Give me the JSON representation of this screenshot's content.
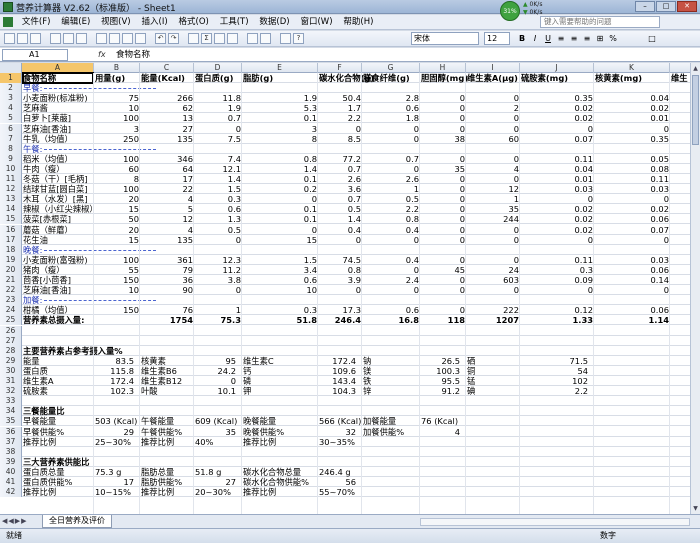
{
  "window": {
    "title": "营养计算器 V2.62（标准版） - Sheet1"
  },
  "system_monitor": {
    "cpu": "31%",
    "up": "0K/s",
    "down": "0K/s"
  },
  "menu": {
    "items": [
      "文件(F)",
      "编辑(E)",
      "视图(V)",
      "插入(I)",
      "格式(O)",
      "工具(T)",
      "数据(D)",
      "窗口(W)",
      "帮助(H)"
    ],
    "help_placeholder": "键入需要帮助的问题"
  },
  "toolbar": {
    "font": "宋体",
    "size": "12",
    "bold": "B",
    "italic": "I",
    "underline": "U"
  },
  "formula": {
    "cell": "A1",
    "fx": "fx",
    "value": "食物名称"
  },
  "columns": [
    "A",
    "B",
    "C",
    "D",
    "E",
    "F",
    "G",
    "H",
    "I",
    "J",
    "K"
  ],
  "header_row": [
    "食物名称",
    "用量(g)",
    "能量(Kcal)",
    "蛋白质(g)",
    "脂肪(g)",
    "碳水化合物(g)",
    "膳食纤维(g)",
    "胆固醇(mg)",
    "维生素A(μg)",
    "硫胺素(mg)",
    "核黄素(mg)",
    "维生"
  ],
  "rows": [
    {
      "n": "2",
      "kind": "section",
      "label": "早餐:"
    },
    {
      "n": "3",
      "cells": [
        "小麦面粉(标准粉)",
        "75",
        "266",
        "11.8",
        "1.9",
        "50.4",
        "2.8",
        "0",
        "0",
        "0.35",
        "0.04"
      ]
    },
    {
      "n": "4",
      "cells": [
        "芝麻酱",
        "10",
        "62",
        "1.9",
        "5.3",
        "1.7",
        "0.6",
        "0",
        "2",
        "0.02",
        "0.02"
      ]
    },
    {
      "n": "5",
      "cells": [
        "白萝卜[莱菔]",
        "100",
        "13",
        "0.7",
        "0.1",
        "2.2",
        "1.8",
        "0",
        "0",
        "0.02",
        "0.01"
      ]
    },
    {
      "n": "6",
      "cells": [
        "芝麻油[香油]",
        "3",
        "27",
        "0",
        "3",
        "0",
        "0",
        "0",
        "0",
        "0",
        "0"
      ]
    },
    {
      "n": "7",
      "cells": [
        "牛乳（均值）",
        "250",
        "135",
        "7.5",
        "8",
        "8.5",
        "0",
        "38",
        "60",
        "0.07",
        "0.35"
      ]
    },
    {
      "n": "8",
      "kind": "section",
      "label": "午餐:"
    },
    {
      "n": "9",
      "cells": [
        "稻米（均值）",
        "100",
        "346",
        "7.4",
        "0.8",
        "77.2",
        "0.7",
        "0",
        "0",
        "0.11",
        "0.05"
      ]
    },
    {
      "n": "10",
      "cells": [
        "牛肉（瘦）",
        "60",
        "64",
        "12.1",
        "1.4",
        "0.7",
        "0",
        "35",
        "4",
        "0.04",
        "0.08"
      ]
    },
    {
      "n": "11",
      "cells": [
        "冬菇（干）[毛柄]",
        "8",
        "17",
        "1.4",
        "0.1",
        "2.6",
        "2.6",
        "0",
        "0",
        "0.01",
        "0.11"
      ]
    },
    {
      "n": "12",
      "cells": [
        "结球甘蓝[圆白菜]",
        "100",
        "22",
        "1.5",
        "0.2",
        "3.6",
        "1",
        "0",
        "12",
        "0.03",
        "0.03"
      ]
    },
    {
      "n": "13",
      "cells": [
        "木耳（水发）[黑]",
        "20",
        "4",
        "0.3",
        "0",
        "0.7",
        "0.5",
        "0",
        "1",
        "0",
        "0"
      ]
    },
    {
      "n": "14",
      "cells": [
        "辣椒（小红尖辣椒）",
        "15",
        "5",
        "0.6",
        "0.1",
        "0.5",
        "2.2",
        "0",
        "35",
        "0.02",
        "0.02"
      ]
    },
    {
      "n": "15",
      "cells": [
        "菠菜[赤根菜]",
        "50",
        "12",
        "1.3",
        "0.1",
        "1.4",
        "0.8",
        "0",
        "244",
        "0.02",
        "0.06"
      ]
    },
    {
      "n": "16",
      "cells": [
        "蘑菇（鲜蘑）",
        "20",
        "4",
        "0.5",
        "0",
        "0.4",
        "0.4",
        "0",
        "0",
        "0.02",
        "0.07"
      ]
    },
    {
      "n": "17",
      "cells": [
        "花生油",
        "15",
        "135",
        "0",
        "15",
        "0",
        "0",
        "0",
        "0",
        "0",
        "0"
      ]
    },
    {
      "n": "18",
      "kind": "section",
      "label": "晚餐:"
    },
    {
      "n": "19",
      "cells": [
        "小麦面粉(富强粉)",
        "100",
        "361",
        "12.3",
        "1.5",
        "74.5",
        "0.4",
        "0",
        "0",
        "0.11",
        "0.03"
      ]
    },
    {
      "n": "20",
      "cells": [
        "猪肉（瘦）",
        "55",
        "79",
        "11.2",
        "3.4",
        "0.8",
        "0",
        "45",
        "24",
        "0.3",
        "0.06"
      ]
    },
    {
      "n": "21",
      "cells": [
        "茴香[小茴香]",
        "150",
        "36",
        "3.8",
        "0.6",
        "3.9",
        "2.4",
        "0",
        "603",
        "0.09",
        "0.14"
      ]
    },
    {
      "n": "22",
      "cells": [
        "芝麻油[香油]",
        "10",
        "90",
        "0",
        "10",
        "0",
        "0",
        "0",
        "0",
        "0",
        "0"
      ]
    },
    {
      "n": "23",
      "kind": "section",
      "label": "加餐:"
    },
    {
      "n": "24",
      "cells": [
        "柑橘（均值）",
        "150",
        "76",
        "1",
        "0.3",
        "17.3",
        "0.6",
        "0",
        "222",
        "0.12",
        "0.06"
      ]
    },
    {
      "n": "25",
      "kind": "total",
      "cells": [
        "营养素总摄入量:",
        "",
        "1754",
        "75.3",
        "51.8",
        "246.4",
        "16.8",
        "118",
        "1207",
        "1.33",
        "1.14"
      ]
    },
    {
      "n": "26",
      "kind": "empty"
    },
    {
      "n": "27",
      "kind": "empty"
    },
    {
      "n": "28",
      "kind": "title",
      "label": "主要营养素占参考摄入量%"
    },
    {
      "n": "29",
      "kind": "free",
      "cells": [
        [
          "能量",
          "A"
        ],
        [
          "83.5",
          "B"
        ],
        [
          "核黄素",
          "C"
        ],
        [
          "95",
          "D"
        ],
        [
          "维生素C",
          "E"
        ],
        [
          "172.4",
          "F"
        ],
        [
          "钠",
          "G"
        ],
        [
          "26.5",
          "H"
        ],
        [
          "硒",
          "I"
        ],
        [
          "71.5",
          "J"
        ]
      ]
    },
    {
      "n": "30",
      "kind": "free",
      "cells": [
        [
          "蛋白质",
          "A"
        ],
        [
          "115.8",
          "B"
        ],
        [
          "维生素B6",
          "C"
        ],
        [
          "24.2",
          "D"
        ],
        [
          "钙",
          "E"
        ],
        [
          "109.6",
          "F"
        ],
        [
          "镁",
          "G"
        ],
        [
          "100.3",
          "H"
        ],
        [
          "铜",
          "I"
        ],
        [
          "54",
          "J"
        ]
      ]
    },
    {
      "n": "31",
      "kind": "free",
      "cells": [
        [
          "维生素A",
          "A"
        ],
        [
          "172.4",
          "B"
        ],
        [
          "维生素B12",
          "C"
        ],
        [
          "0",
          "D"
        ],
        [
          "磷",
          "E"
        ],
        [
          "143.4",
          "F"
        ],
        [
          "铁",
          "G"
        ],
        [
          "95.5",
          "H"
        ],
        [
          "锰",
          "I"
        ],
        [
          "102",
          "J"
        ]
      ]
    },
    {
      "n": "32",
      "kind": "free",
      "cells": [
        [
          "硫胺素",
          "A"
        ],
        [
          "102.3",
          "B"
        ],
        [
          "叶酸",
          "C"
        ],
        [
          "10.1",
          "D"
        ],
        [
          "钾",
          "E"
        ],
        [
          "104.3",
          "F"
        ],
        [
          "锌",
          "G"
        ],
        [
          "91.2",
          "H"
        ],
        [
          "碘",
          "I"
        ],
        [
          "2.2",
          "J"
        ]
      ]
    },
    {
      "n": "33",
      "kind": "empty"
    },
    {
      "n": "34",
      "kind": "title",
      "label": "三餐能量比"
    },
    {
      "n": "35",
      "kind": "free",
      "cells": [
        [
          "早餐能量",
          "A"
        ],
        [
          "503 (Kcal)",
          "B"
        ],
        [
          "午餐能量",
          "C"
        ],
        [
          "609 (Kcal)",
          "D"
        ],
        [
          "晚餐能量",
          "E"
        ],
        [
          "566 (Kcal)",
          "F"
        ],
        [
          "加餐能量",
          "G"
        ],
        [
          "76 (Kcal)",
          "H"
        ]
      ]
    },
    {
      "n": "36",
      "kind": "free",
      "cells": [
        [
          "早餐供能%",
          "A"
        ],
        [
          "29",
          "B"
        ],
        [
          "午餐供能%",
          "C"
        ],
        [
          "35",
          "D"
        ],
        [
          "晚餐供能%",
          "E"
        ],
        [
          "32",
          "F"
        ],
        [
          "加餐供能%",
          "G"
        ],
        [
          "4",
          "H"
        ]
      ]
    },
    {
      "n": "37",
      "kind": "free",
      "cells": [
        [
          "推荐比例",
          "A"
        ],
        [
          "25~30%",
          "B"
        ],
        [
          "推荐比例",
          "C"
        ],
        [
          "40%",
          "D"
        ],
        [
          "推荐比例",
          "E"
        ],
        [
          "30~35%",
          "F"
        ]
      ]
    },
    {
      "n": "38",
      "kind": "empty"
    },
    {
      "n": "39",
      "kind": "title",
      "label": "三大营养素供能比"
    },
    {
      "n": "40",
      "kind": "free",
      "cells": [
        [
          "蛋白质总量",
          "A"
        ],
        [
          "75.3 g",
          "B"
        ],
        [
          "脂肪总量",
          "C"
        ],
        [
          "51.8 g",
          "D"
        ],
        [
          "碳水化合物总量",
          "E"
        ],
        [
          "246.4 g",
          "F"
        ]
      ]
    },
    {
      "n": "41",
      "kind": "free",
      "cells": [
        [
          "蛋白质供能%",
          "A"
        ],
        [
          "17",
          "B"
        ],
        [
          "脂肪供能%",
          "C"
        ],
        [
          "27",
          "D"
        ],
        [
          "碳水化合物供能%",
          "E"
        ],
        [
          "56",
          "F"
        ]
      ]
    },
    {
      "n": "42",
      "kind": "free",
      "cells": [
        [
          "推荐比例",
          "A"
        ],
        [
          "10~15%",
          "B"
        ],
        [
          "推荐比例",
          "C"
        ],
        [
          "20~30%",
          "D"
        ],
        [
          "推荐比例",
          "E"
        ],
        [
          "55~70%",
          "F"
        ]
      ]
    }
  ],
  "sheet_tab": "全日营养及评价",
  "status": {
    "left": "就绪",
    "mode": "数字"
  }
}
